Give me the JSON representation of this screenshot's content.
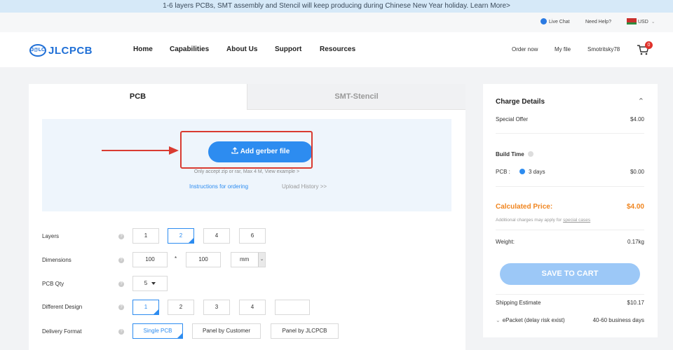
{
  "banner": {
    "text": "1-6 layers PCBs, SMT assembly and Stencil will keep producing during Chinese New Year holiday. Learn More>"
  },
  "topbar": {
    "live_chat": "Live Chat",
    "need_help": "Need Help?",
    "currency": "USD"
  },
  "nav": {
    "logo_badge": "J@LC",
    "logo_text": "JLCPCB",
    "links": [
      "Home",
      "Capabilities",
      "About Us",
      "Support",
      "Resources"
    ],
    "order_now": "Order now",
    "my_file": "My file",
    "username": "Smotritsky78",
    "cart_count": "0"
  },
  "tabs": {
    "pcb": "PCB",
    "smt": "SMT-Stencil"
  },
  "upload": {
    "button_label": "Add gerber file",
    "hint": "Only accept zip or rar, Max 4 M, View example >",
    "instructions": "Instructions for ordering",
    "history": "Upload History >>"
  },
  "form": {
    "layers": {
      "label": "Layers",
      "options": [
        "1",
        "2",
        "4",
        "6"
      ],
      "selected": "2"
    },
    "dimensions": {
      "label": "Dimensions",
      "width": "100",
      "separator": "*",
      "height": "100",
      "unit": "mm"
    },
    "pcb_qty": {
      "label": "PCB Qty",
      "value": "5"
    },
    "different_design": {
      "label": "Different Design",
      "options": [
        "1",
        "2",
        "3",
        "4"
      ],
      "selected": "1"
    },
    "delivery_format": {
      "label": "Delivery Format",
      "options": [
        "Single PCB",
        "Panel by Customer",
        "Panel by JLCPCB"
      ],
      "selected": "Single PCB"
    },
    "help_glyph": "?"
  },
  "charge": {
    "title": "Charge Details",
    "special_offer_label": "Special Offer",
    "special_offer_value": "$4.00",
    "build_time_label": "Build Time",
    "pcb_label": "PCB :",
    "pcb_days": "3 days",
    "pcb_price": "$0.00",
    "calc_label": "Calculated Price:",
    "calc_value": "$4.00",
    "additional_note": "Additional charges may apply for",
    "special_cases": "special cases",
    "weight_label": "Weight:",
    "weight_value": "0.17kg",
    "save_button": "SAVE TO CART",
    "shipping_label": "Shipping Estimate",
    "shipping_value": "$10.17",
    "method": "ePacket (delay risk exist)",
    "method_days": "40-60 business days"
  },
  "colors": {
    "accent": "#2d8cf0",
    "brand": "#1f6fd6",
    "price": "#f0851f",
    "highlight": "#d93b31"
  }
}
